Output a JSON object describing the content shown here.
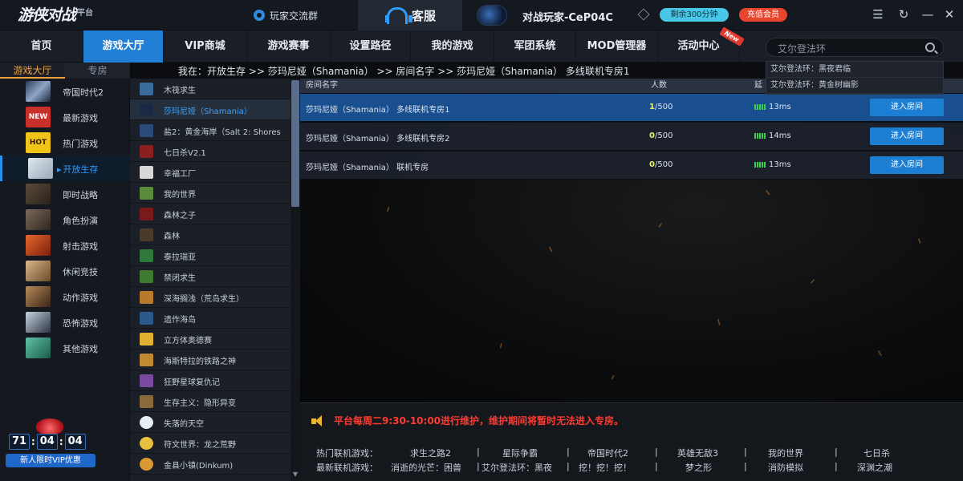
{
  "topbar": {
    "logo_text": "游侠对战",
    "logo_suffix": "平台",
    "exchange_group": "玩家交流群",
    "service": "客服",
    "username": "对战玩家-CeP04C",
    "remain": "剩余300分钟",
    "vip_button": "充值会员"
  },
  "nav": {
    "items": [
      "首页",
      "游戏大厅",
      "VIP商城",
      "游戏赛事",
      "设置路径",
      "我的游戏",
      "军团系统",
      "MOD管理器",
      "活动中心"
    ],
    "active": "游戏大厅",
    "new_badge": "New",
    "search_placeholder": "艾尔登法环",
    "suggestions": [
      "艾尔登法环：黑夜君临",
      "艾尔登法环：黄金树幽影"
    ]
  },
  "left": {
    "tabs": [
      "游戏大厅",
      "专房"
    ],
    "categories": [
      "帝国时代2",
      "最新游戏",
      "热门游戏",
      "开放生存",
      "即时战略",
      "角色扮演",
      "射击游戏",
      "休闲竞技",
      "动作游戏",
      "恐怖游戏",
      "其他游戏"
    ],
    "active_category": "开放生存",
    "promo": {
      "timer": [
        "71",
        "04",
        "04"
      ],
      "text": "新人限时VIP优惠"
    }
  },
  "breadcrumb": "我在：开放生存 >> 莎玛尼娅（Shamania） >> 房间名字 >> 莎玛尼娅（Shamania） 多线联机专房1",
  "games": [
    "木筏求生",
    "莎玛尼娅（Shamania）",
    "盐2：黄金海岸（Salt 2: Shores",
    "七日杀V2.1",
    "幸福工厂",
    "我的世界",
    "森林之子",
    "森林",
    "泰拉瑞亚",
    "禁闭求生",
    "深海搁浅（荒岛求生）",
    "遗作海岛",
    "立方体奥德赛",
    "海斯特拉的铁路之神",
    "狂野星球复仇记",
    "生存主义：隐形异变",
    "失落的天空",
    "符文世界：龙之荒野",
    "金县小镇(Dinkum)"
  ],
  "active_game": "莎玛尼娅（Shamania）",
  "table": {
    "headers": {
      "name": "房间名字",
      "count": "人数",
      "ping": "延"
    },
    "rooms": [
      {
        "name": "莎玛尼娅（Shamania） 多线联机专房1",
        "current": "1",
        "max": "/500",
        "ping": "13ms",
        "action": "进入房间"
      },
      {
        "name": "莎玛尼娅（Shamania） 多线联机专房2",
        "current": "0",
        "max": "/500",
        "ping": "14ms",
        "action": "进入房间"
      },
      {
        "name": "莎玛尼娅（Shamania） 联机专房",
        "current": "0",
        "max": "/500",
        "ping": "13ms",
        "action": "进入房间"
      }
    ]
  },
  "bottom": {
    "notice": "平台每周二9:30-10:00进行维护，维护期间将暂时无法进入专房。",
    "hot_label": "热门联机游戏：",
    "hot_games": [
      "求生之路2",
      "星际争霸",
      "帝国时代2",
      "英雄无敌3",
      "我的世界",
      "七日杀"
    ],
    "new_label": "最新联机游戏：",
    "new_games": [
      "消逝的光芒：困兽",
      "艾尔登法环：黑夜",
      "挖！挖！挖！",
      "梦之形",
      "消防模拟",
      "深渊之潮"
    ]
  },
  "colors": {
    "accent": "#2180d6",
    "notice": "#ff3b30",
    "tab_active": "#f2a23a"
  }
}
